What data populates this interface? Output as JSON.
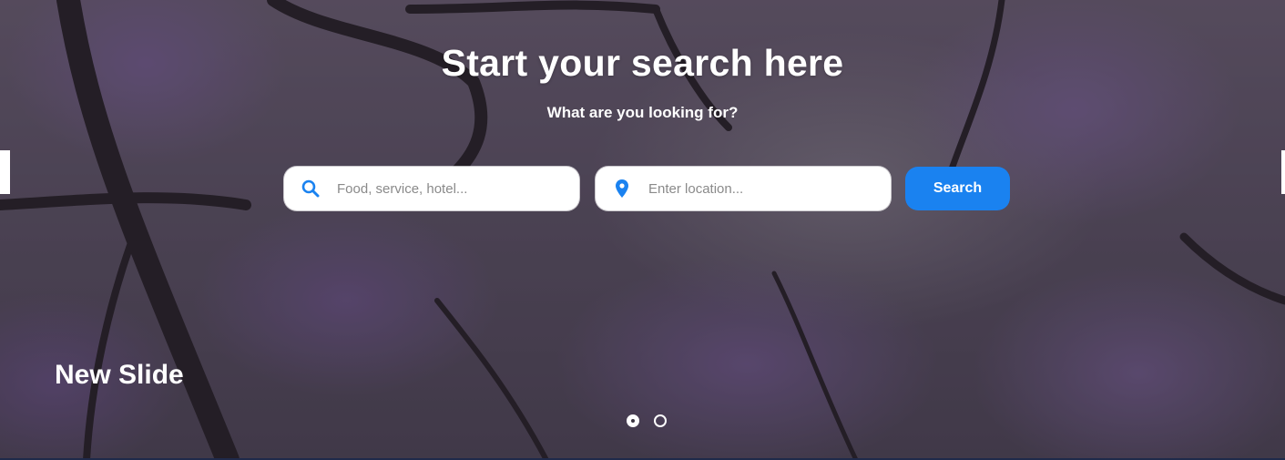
{
  "hero": {
    "title": "Start your search here",
    "subtitle": "What are you looking for?",
    "slide_label": "New Slide"
  },
  "search": {
    "what_placeholder": "Food, service, hotel...",
    "what_icon": "search-icon",
    "where_placeholder": "Enter location...",
    "where_icon": "map-pin-icon",
    "button_label": "Search"
  },
  "slider": {
    "dot_count": 2,
    "active_index": 0
  },
  "colors": {
    "accent": "#1a82f0",
    "text": "#ffffff"
  }
}
